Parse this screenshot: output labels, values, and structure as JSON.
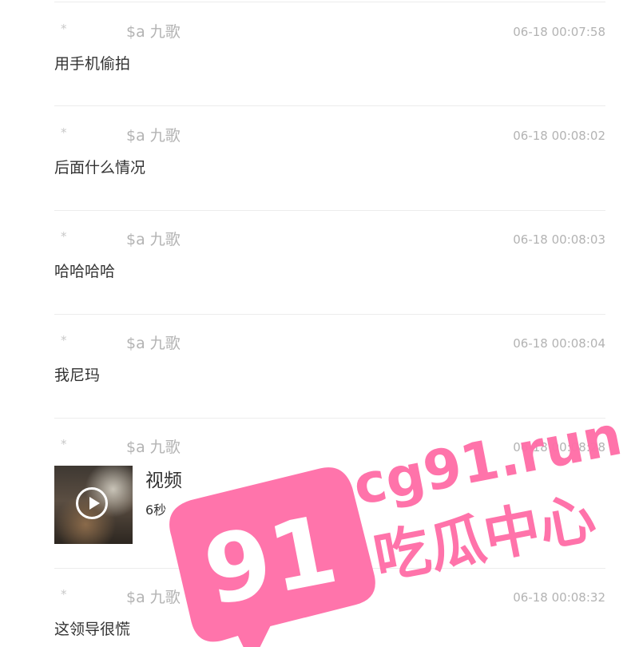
{
  "messages": [
    {
      "sender": "$a 九歌",
      "time": "06-18 00:07:58",
      "text": "用手机偷拍"
    },
    {
      "sender": "$a 九歌",
      "time": "06-18 00:08:02",
      "text": "后面什么情况"
    },
    {
      "sender": "$a 九歌",
      "time": "06-18 00:08:03",
      "text": "哈哈哈哈"
    },
    {
      "sender": "$a 九歌",
      "time": "06-18 00:08:04",
      "text": "我尼玛"
    },
    {
      "sender": "$a 九歌",
      "time": "06-18 00:08:28",
      "video": {
        "title": "视频",
        "duration": "6秒"
      }
    },
    {
      "sender": "$a 九歌",
      "time": "06-18 00:08:32",
      "text": "这领导很慌"
    }
  ],
  "star_glyph": "*",
  "watermark": {
    "number": "91",
    "domain": "cg91.run",
    "tagline": "吃瓜中心",
    "color": "#ff6fa8"
  }
}
